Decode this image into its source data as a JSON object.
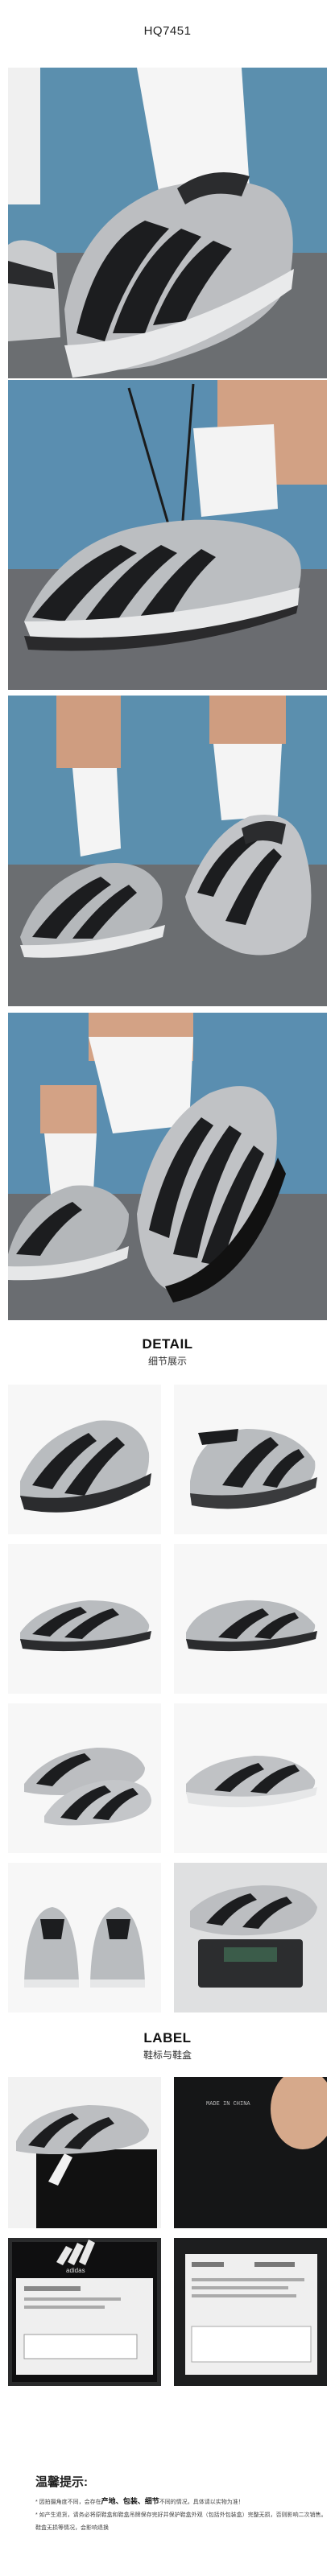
{
  "product_code": "HQ7451",
  "detail": {
    "title": "DETAIL",
    "subtitle": "细节展示"
  },
  "label": {
    "title": "LABEL",
    "subtitle": "鞋标与鞋盒",
    "tag_text": "MADE IN CHINA",
    "box_brand": "adidas"
  },
  "tips": {
    "title": "温馨提示:",
    "line1_prefix": "* 因拍摄角度不同，会存在",
    "highlight1": "产地、",
    "highlight2": "包装、",
    "highlight3": "细节",
    "line1_suffix": "不同的情况，具体请以实物为准！",
    "line2": "* 如产生退货，请务必将原鞋盒和鞋盒吊牌保存完好并保护鞋盒外观（包括外包装盒）完整无损，否则影响二次销售。",
    "line3": "   鞋盒无损等情况，会影响退换"
  },
  "colors": {
    "sky": "#5a8fb0",
    "ground": "#6a6d70",
    "shoe_silver": "#b9bcbf",
    "shoe_black": "#1b1c1e",
    "sock": "#f4f4f4"
  }
}
